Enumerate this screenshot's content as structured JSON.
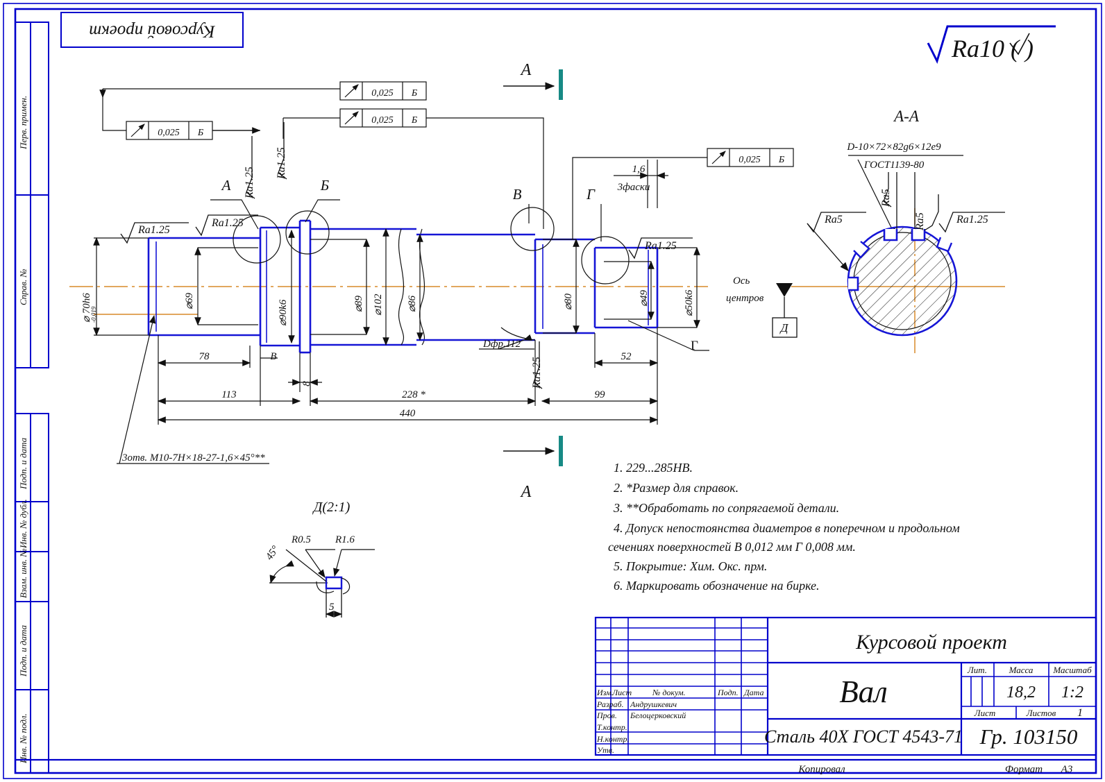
{
  "sheet": {
    "format_label": "Формат",
    "format_value": "А3",
    "copied_label": "Копировал",
    "corner_title": "Курсовой проект",
    "surface_note": "Ra10 (    )"
  },
  "left_margin": {
    "fields": [
      {
        "label": "Перв. примен."
      },
      {
        "label": "Справ. №"
      },
      {
        "label": "Подп. и дата"
      },
      {
        "label": "Инв. № дубл."
      },
      {
        "label": "Взам. инв. №"
      },
      {
        "label": "Подп. и дата"
      },
      {
        "label": "Инв. № подл."
      }
    ]
  },
  "main_view": {
    "section_marker_top": "А",
    "section_marker_bottom": "А",
    "datum_labels": [
      "А",
      "Б",
      "В",
      "Г"
    ],
    "diameters": [
      {
        "id": "d1",
        "text": "⌀ 70h6",
        "tol": "-0,019"
      },
      {
        "id": "d2",
        "text": "⌀69"
      },
      {
        "id": "d3",
        "text": "⌀90k6"
      },
      {
        "id": "d4",
        "text": "⌀89"
      },
      {
        "id": "d5",
        "text": "⌀102"
      },
      {
        "id": "d6",
        "text": "⌀86"
      },
      {
        "id": "d7",
        "text": "⌀80"
      },
      {
        "id": "d8",
        "text": "⌀49"
      },
      {
        "id": "d9",
        "text": "⌀50k6"
      }
    ],
    "lengths": [
      {
        "id": "L78",
        "text": "78"
      },
      {
        "id": "LB",
        "text": "B"
      },
      {
        "id": "L113",
        "text": "113"
      },
      {
        "id": "L8",
        "text": "8"
      },
      {
        "id": "L228",
        "text": "228 *"
      },
      {
        "id": "L52",
        "text": "52"
      },
      {
        "id": "L99",
        "text": "99"
      },
      {
        "id": "L440",
        "text": "440"
      },
      {
        "id": "L16",
        "text": "1,6"
      },
      {
        "id": "Lfaski",
        "text": "3фаски"
      }
    ],
    "roughness": [
      {
        "id": "r1",
        "text": "Ra1.25"
      },
      {
        "id": "r2",
        "text": "Ra1.25"
      },
      {
        "id": "r3",
        "text": "Ra1.25"
      },
      {
        "id": "r4",
        "text": "Ra1.25"
      },
      {
        "id": "r5",
        "text": "Ra1.25"
      },
      {
        "id": "r6",
        "text": "Ra1.25"
      },
      {
        "id": "r7",
        "text": "Ra1.25"
      }
    ],
    "fcf": [
      {
        "id": "f1",
        "sym": "runout",
        "tol": "0,025",
        "datum": "Б"
      },
      {
        "id": "f2",
        "sym": "runout",
        "tol": "0,025",
        "datum": "Б"
      },
      {
        "id": "f3",
        "sym": "runout",
        "tol": "0,025",
        "datum": "Б"
      },
      {
        "id": "f4",
        "sym": "runout",
        "tol": "0,025",
        "datum": "Б"
      }
    ],
    "leader_notes": [
      {
        "id": "n_thread",
        "text": "3отв. М10-7Н×18-27-1,6×45°**"
      },
      {
        "id": "n_cutter",
        "text": "Dфр.112"
      },
      {
        "id": "n_axis1",
        "text": "Ось"
      },
      {
        "id": "n_axis2",
        "text": "центров"
      },
      {
        "id": "n_detail_ref",
        "text": "Д"
      }
    ]
  },
  "section_aa": {
    "title": "А-А",
    "spline_top": "D-10×72×82g6×12e9",
    "spline_bottom": "ГОСТ1139-80",
    "roughness": [
      {
        "id": "s1",
        "text": "Ra5"
      },
      {
        "id": "s2",
        "text": "Ra5"
      },
      {
        "id": "s3",
        "text": "Ra5"
      },
      {
        "id": "s4",
        "text": "Ra1.25"
      }
    ]
  },
  "detail_d": {
    "title": "Д(2:1)",
    "radius_small": "R0.5",
    "radius_large": "R1.6",
    "angle": "45°",
    "depth": "5"
  },
  "notes": {
    "items": [
      "1. 229...285HB.",
      "2.  *Размер для справок.",
      "3.  **Обработать по сопрягаемой детали.",
      "4. Допуск  непостоянства  диаметров  в  поперечном  и  продольном",
      "сечениях поверхностей В 0,012 мм Г 0,008 мм.",
      "5. Покрытие: Хим. Окс. прм.",
      "6. Маркировать обозначение на бирке."
    ]
  },
  "title_block": {
    "rev_headers": [
      "Изм.",
      "Лист",
      "№ докум.",
      "Подп.",
      "Дата"
    ],
    "roles": [
      {
        "role": "Разраб.",
        "name": "Андрушкевич"
      },
      {
        "role": "Пров.",
        "name": "Белоцерковский"
      },
      {
        "role": "Т.контр.",
        "name": ""
      },
      {
        "role": "",
        "name": ""
      },
      {
        "role": "Н.контр.",
        "name": ""
      },
      {
        "role": "Утв.",
        "name": ""
      }
    ],
    "project_title": "Курсовой проект",
    "part_name": "Вал",
    "material": "Сталь 40Х ГОСТ 4543-71",
    "designation": "Гр. 103150",
    "lit_label": "Лит.",
    "mass_label": "Масса",
    "scale_label": "Масштаб",
    "mass_value": "18,2",
    "scale_value": "1:2",
    "sheet_label": "Лист",
    "sheets_label": "Листов",
    "sheets_value": "1"
  },
  "colors": {
    "frame": "#0000cc",
    "part": "#1515d6",
    "axis": "#d98a28",
    "section_mark": "#178a85",
    "ink": "#111111"
  }
}
